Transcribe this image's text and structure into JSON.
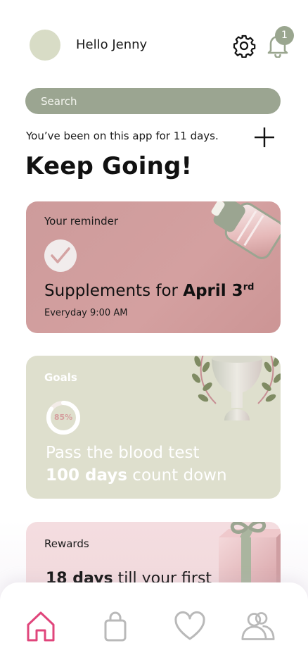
{
  "header": {
    "greeting": "Hello Jenny",
    "notification_count": "1"
  },
  "search": {
    "placeholder": "Search"
  },
  "streak": {
    "text": "You’ve been on this app for 11 days.",
    "heading": "Keep Going!"
  },
  "reminder": {
    "label": "Your reminder",
    "title_prefix": "Supplements for ",
    "title_date": "April 3",
    "title_suffix": "rd",
    "schedule": "Everyday 9:00 AM"
  },
  "goals": {
    "label": "Goals",
    "progress_text": "85%",
    "progress": 0.85,
    "line1": "Pass the blood test",
    "line2_bold": "100 days",
    "line2_rest": " count down"
  },
  "rewards": {
    "label": "Rewards",
    "text_bold": "18 days",
    "text_rest": " till your first"
  },
  "nav": {
    "items": [
      "home-icon",
      "shopping-bag-icon",
      "heart-icon",
      "community-icon"
    ],
    "active": "home-icon"
  },
  "colors": {
    "accent": "#e0457b",
    "sage": "#9ba591",
    "reminder_card": "#cd9b9b",
    "goals_card": "#dedfcd",
    "rewards_card": "#f4dde0"
  }
}
